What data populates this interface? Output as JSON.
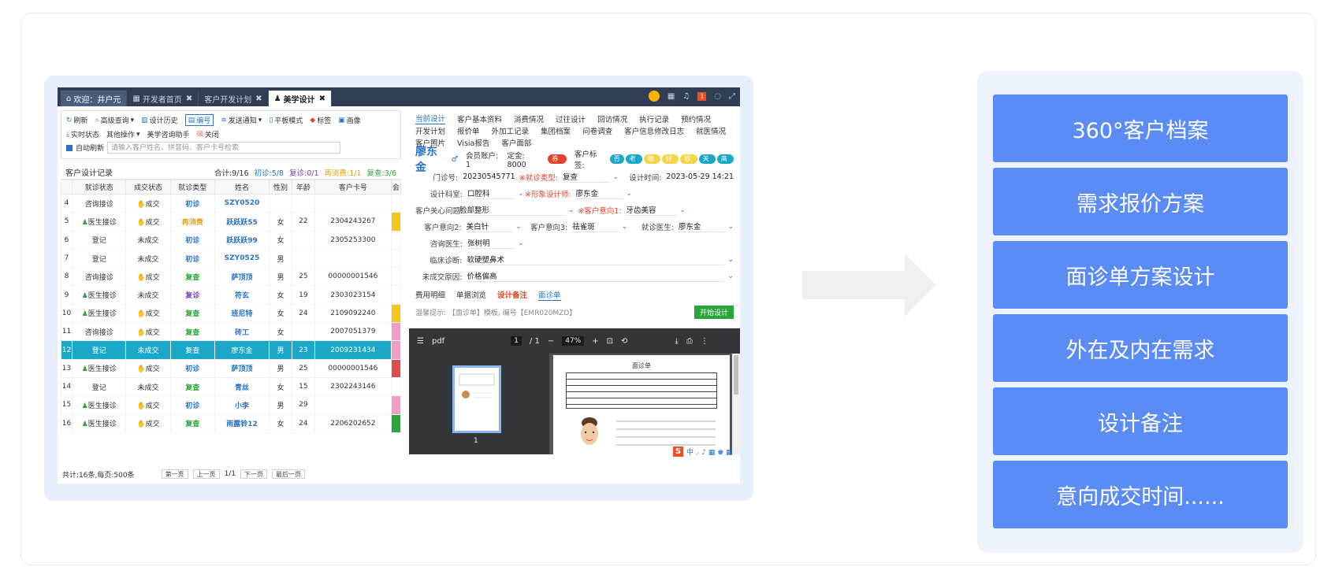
{
  "tabs": [
    {
      "label": "欢迎：井户元",
      "closable": false
    },
    {
      "label": "开发者首页",
      "closable": true
    },
    {
      "label": "客户开发计划",
      "closable": true
    },
    {
      "label": "美学设计",
      "closable": true
    }
  ],
  "badge_count": "1",
  "toolbar": {
    "row1": [
      "刷新",
      "高级查询",
      "设计历史",
      "编号",
      "发送通知",
      "平板模式",
      "标签",
      "画像"
    ],
    "row2": [
      "实时状态",
      "其他操作",
      "美学咨询助手",
      "关闭"
    ],
    "auto_refresh": "自动刷新",
    "search_placeholder": "请输入客户姓名、拼音码、客户卡号检索"
  },
  "records": {
    "title": "客户设计记录",
    "stats": [
      "合计:9/16",
      "初诊:5/8",
      "复诊:0/1",
      "再消费:1/1",
      "复查:3/6"
    ],
    "columns": [
      "就诊状态",
      "成交状态",
      "就诊类型",
      "姓名",
      "性别",
      "年龄",
      "客户卡号",
      "会"
    ],
    "rows": [
      {
        "no": "4",
        "visit": "咨询接诊",
        "deal": "成交",
        "type": "初诊",
        "name": "SZY0520",
        "sex": "",
        "age": "",
        "card": "",
        "type_cls": "st-blue",
        "bar": ""
      },
      {
        "no": "5",
        "visit": "医生接诊",
        "deal": "成交",
        "type": "再消费",
        "name": "跃跃跃55",
        "sex": "女",
        "age": "22",
        "card": "2304243267",
        "type_cls": "st-orange",
        "bar": "#f5c518"
      },
      {
        "no": "6",
        "visit": "登记",
        "deal": "未成交",
        "type": "初诊",
        "name": "跃跃跃99",
        "sex": "女",
        "age": "",
        "card": "2305253300",
        "type_cls": "st-blue",
        "bar": ""
      },
      {
        "no": "7",
        "visit": "登记",
        "deal": "未成交",
        "type": "初诊",
        "name": "SZY0525",
        "sex": "男",
        "age": "",
        "card": "",
        "type_cls": "st-blue",
        "bar": ""
      },
      {
        "no": "8",
        "visit": "咨询接诊",
        "deal": "成交",
        "type": "复查",
        "name": "萨顶顶",
        "sex": "男",
        "age": "25",
        "card": "00000001546",
        "type_cls": "st-green",
        "bar": ""
      },
      {
        "no": "9",
        "visit": "医生接诊",
        "deal": "未成交",
        "type": "复诊",
        "name": "符玄",
        "sex": "女",
        "age": "19",
        "card": "2303023154",
        "type_cls": "st-purple",
        "bar": ""
      },
      {
        "no": "10",
        "visit": "医生接诊",
        "deal": "成交",
        "type": "复查",
        "name": "班尼特",
        "sex": "女",
        "age": "24",
        "card": "2109092240",
        "type_cls": "st-green",
        "bar": "#f5c518"
      },
      {
        "no": "11",
        "visit": "咨询接诊",
        "deal": "成交",
        "type": "复查",
        "name": "砖工",
        "sex": "女",
        "age": "",
        "card": "2007051379",
        "type_cls": "st-green",
        "bar": "#f29cc6"
      },
      {
        "no": "12",
        "visit": "登记",
        "deal": "未成交",
        "type": "复查",
        "name": "廖东金",
        "sex": "男",
        "age": "23",
        "card": "2009231434",
        "type_cls": "",
        "bar": "#f29cc6",
        "selected": true
      },
      {
        "no": "13",
        "visit": "医生接诊",
        "deal": "成交",
        "type": "初诊",
        "name": "萨顶顶",
        "sex": "男",
        "age": "25",
        "card": "00000001546",
        "type_cls": "st-blue",
        "bar": "#e04b4b"
      },
      {
        "no": "14",
        "visit": "登记",
        "deal": "未成交",
        "type": "复查",
        "name": "青丝",
        "sex": "女",
        "age": "15",
        "card": "2302243146",
        "type_cls": "st-green",
        "bar": ""
      },
      {
        "no": "15",
        "visit": "医生接诊",
        "deal": "成交",
        "type": "初诊",
        "name": "小李",
        "sex": "男",
        "age": "29",
        "card": "",
        "type_cls": "st-blue",
        "bar": "#f29cc6"
      },
      {
        "no": "16",
        "visit": "医生接诊",
        "deal": "成交",
        "type": "复查",
        "name": "雨露铃12",
        "sex": "女",
        "age": "24",
        "card": "2206202652",
        "type_cls": "st-green",
        "bar": "#2aa53a"
      }
    ],
    "footer": "共计:16条,每页:500条",
    "pager": [
      "第一页",
      "上一页",
      "1/1",
      "下一页",
      "最后一页"
    ]
  },
  "detail_tabs": {
    "row1": [
      "当前设计",
      "客户基本资料",
      "消费情况",
      "过往设计",
      "回访情况",
      "执行记录",
      "预约情况"
    ],
    "row2": [
      "开发计划",
      "报价单",
      "外加工记录",
      "集团档案",
      "问卷调查",
      "客户信息修改日志",
      "就医情况"
    ],
    "row3": [
      "客户照片",
      "Visia报告",
      "客户面部"
    ]
  },
  "customer": {
    "name": "廖东金",
    "sex_symbol": "♂",
    "account": "会员账户: 1",
    "deposit": "定金: 8000",
    "card_tag": "券卡",
    "tags_label": "客户标签:",
    "tags": [
      "否",
      "老客",
      "敏感",
      "好评",
      "容忍",
      "关怀",
      "高价"
    ],
    "tag_colors": [
      "#1aa7c8",
      "#1aa7c8",
      "#f5d447",
      "#f5d447",
      "#f5d447",
      "#1aa7c8",
      "#1aa7c8"
    ],
    "fields": {
      "clinic_no_label": "门诊号:",
      "clinic_no": "20230545771",
      "visit_type_label": "※就诊类型:",
      "visit_type": "复查",
      "design_time_label": "设计时间:",
      "design_time": "2023-05-29 14:21",
      "dept_label": "设计科室:",
      "dept": "口腔科",
      "designer_label": "※形象设计师:",
      "designer": "廖东金",
      "concern_label": "客户关心问题:",
      "concern": "脸部整形",
      "intent1_label": "※客户意向1:",
      "intent1": "牙齿美容",
      "intent2_label": "客户意向2:",
      "intent2": "美白针",
      "intent3_label": "客户意向3:",
      "intent3": "祛雀斑",
      "doctor_label": "就诊医生:",
      "doctor": "廖东金",
      "consult_doctor_label": "咨询医生:",
      "consult_doctor": "张树明",
      "clinical_label": "临床诊断:",
      "clinical": "软硬塑鼻术",
      "reason_label": "未成交原因:",
      "reason": "价格偏高"
    }
  },
  "sub_tabs": [
    "费用明细",
    "单据浏览",
    "设计备注",
    "面诊单"
  ],
  "hint": "温馨提示: 【面诊单】模板, 编号【EMR020MZD】",
  "start_design": "开始设计",
  "pdf": {
    "name": "pdf",
    "page": "1",
    "pages": "/ 1",
    "zoom": "47%",
    "thumb_no": "1",
    "doc_title": "面诊单"
  },
  "features": [
    "360°客户档案",
    "需求报价方案",
    "面诊单方案设计",
    "外在及内在需求",
    "设计备注",
    "意向成交时间......"
  ]
}
